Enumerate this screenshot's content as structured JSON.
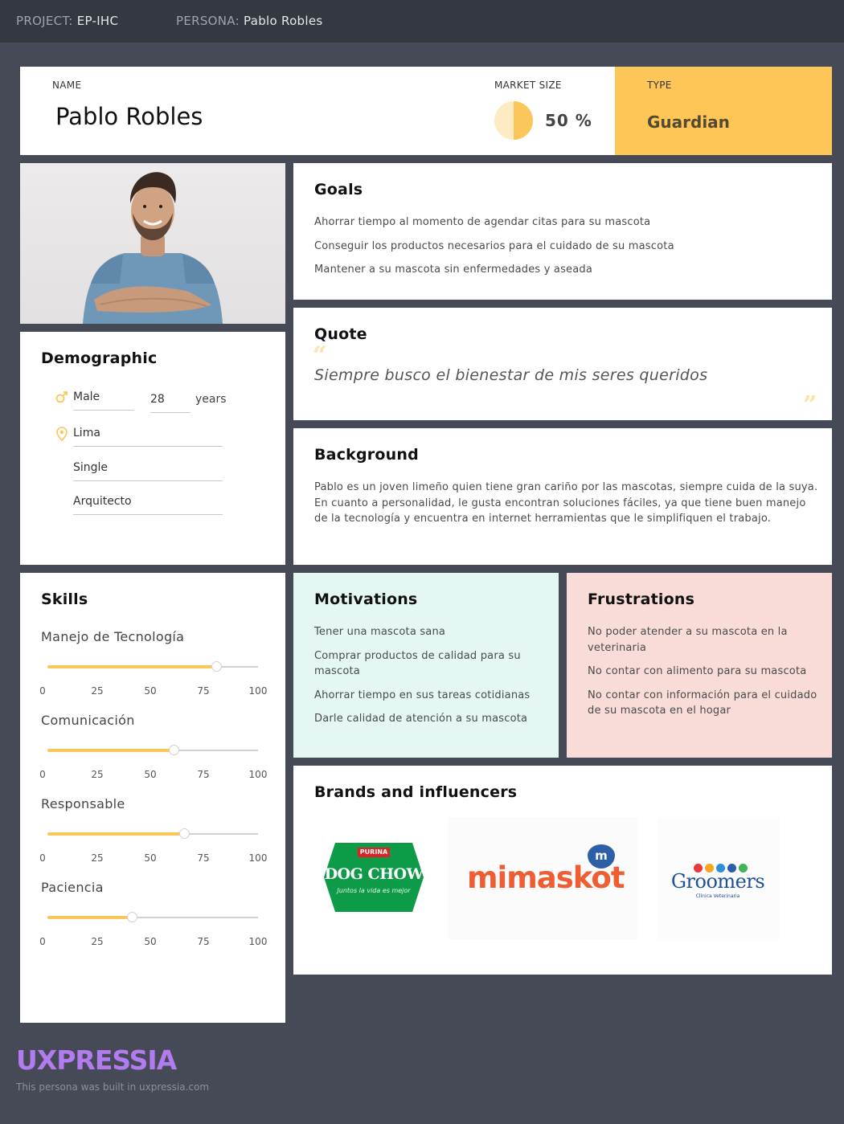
{
  "topbar": {
    "project_label": "PROJECT:",
    "project_value": "EP-IHC",
    "persona_label": "PERSONA:",
    "persona_value": "Pablo Robles"
  },
  "header": {
    "name_label": "NAME",
    "name": "Pablo Robles",
    "market_label": "MARKET SIZE",
    "market_value": "50 %",
    "market_fraction": 0.5,
    "type_label": "TYPE",
    "type_value": "Guardian"
  },
  "demographic": {
    "title": "Demographic",
    "gender": "Male",
    "age": "28",
    "age_unit": "years",
    "location": "Lima",
    "status": "Single",
    "occupation": "Arquitecto"
  },
  "goals": {
    "title": "Goals",
    "items": [
      "Ahorrar tiempo al momento de agendar citas para su mascota",
      "Conseguir los productos necesarios para el cuidado de su mascota",
      "Mantener a su mascota sin enfermedades y aseada"
    ]
  },
  "quote": {
    "title": "Quote",
    "text": "Siempre busco el bienestar de mis seres queridos"
  },
  "background": {
    "title": "Background",
    "text": "Pablo es un joven limeño quien tiene gran cariño por las mascotas, siempre cuida de la suya. En cuanto a personalidad, le gusta encontran soluciones fáciles, ya que tiene buen manejo de la tecnología y encuentra en internet herramientas que le simplifiquen el trabajo."
  },
  "skills": {
    "title": "Skills",
    "tick_labels": [
      "0",
      "25",
      "50",
      "75",
      "100"
    ],
    "items": [
      {
        "name": "Manejo de Tecnología",
        "value": 80
      },
      {
        "name": "Comunicación",
        "value": 60
      },
      {
        "name": "Responsable",
        "value": 65
      },
      {
        "name": "Paciencia",
        "value": 40
      }
    ]
  },
  "motivations": {
    "title": "Motivations",
    "items": [
      "Tener una mascota sana",
      "Comprar productos de calidad para su mascota",
      "Ahorrar tiempo en sus tareas cotidianas",
      "Darle calidad de atención a su mascota"
    ]
  },
  "frustrations": {
    "title": "Frustrations",
    "items": [
      "No poder atender a su mascota en la veterinaria",
      "No contar con alimento para su mascota",
      "No contar con información para el cuidado de su mascota en el hogar"
    ]
  },
  "brands": {
    "title": "Brands and influencers",
    "dogchow_top": "PURINA",
    "dogchow_main": "DOG CHOW",
    "dogchow_tag": "Juntos la vida es mejor",
    "mimaskot": "mimaskot",
    "mimaskot_badge": "m",
    "groomers": "Groomers",
    "groomers_sub": "Clínica Veterinaria"
  },
  "footer": {
    "logo": "UXPRESSIA",
    "note": "This persona was built in uxpressia.com"
  },
  "colors": {
    "accent": "#fbc75a",
    "type_bg": "#fdc657",
    "motivations_bg": "#e4f7f2",
    "frustrations_bg": "#f9dcd8",
    "page_bg": "#464a56"
  }
}
